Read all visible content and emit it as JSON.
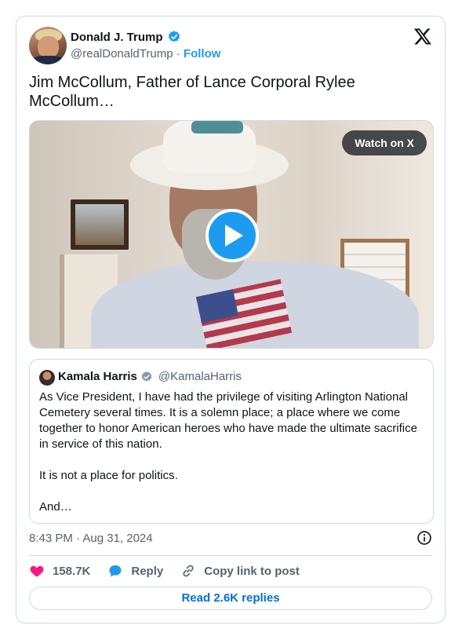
{
  "author": {
    "name": "Donald J. Trump",
    "handle": "@realDonaldTrump",
    "separator": "·",
    "follow_label": "Follow",
    "verified": true
  },
  "brand_icon": "x-logo-icon",
  "tweet": {
    "text": "Jim McCollum, Father of Lance Corporal Rylee McCollum…",
    "timestamp": "8:43 PM · Aug 31, 2024"
  },
  "media": {
    "watch_label": "Watch on X",
    "play_icon": "play-icon"
  },
  "quoted_tweet": {
    "name": "Kamala Harris",
    "handle": "@KamalaHarris",
    "verified": true,
    "text": "As Vice President, I have had the privilege of visiting Arlington National Cemetery several times. It is a solemn place; a place where we come together to honor American heroes who have made the ultimate sacrifice in service of this nation.\n\nIt is not a place for politics.\n\nAnd…"
  },
  "actions": {
    "like_count": "158.7K",
    "reply_label": "Reply",
    "copy_label": "Copy link to post"
  },
  "read_replies_label": "Read 2.6K replies",
  "colors": {
    "accent": "#1d9bf0",
    "like": "#f91880",
    "muted_text": "#536471",
    "border": "#cfd9de",
    "link_button_text": "#006fd6"
  }
}
